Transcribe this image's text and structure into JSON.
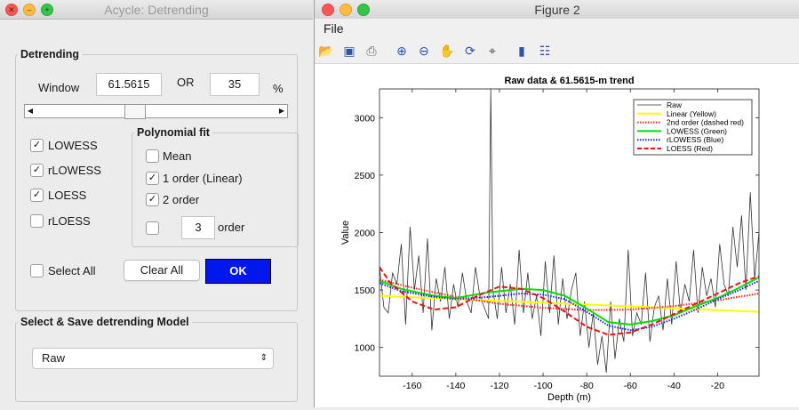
{
  "left_window": {
    "title": "Acycle: Detrending",
    "detrending": {
      "legend": "Detrending",
      "window_label": "Window",
      "window_value": "61.5615",
      "or_label": "OR",
      "percent_value": "35",
      "percent_unit": "%",
      "slider_fraction": 0.4
    },
    "methods": [
      {
        "label": "LOWESS",
        "checked": true
      },
      {
        "label": "rLOWESS",
        "checked": true
      },
      {
        "label": "LOESS",
        "checked": true
      },
      {
        "label": "rLOESS",
        "checked": false
      }
    ],
    "polyfit": {
      "legend": "Polynomial fit",
      "items": [
        {
          "label": "Mean",
          "checked": false
        },
        {
          "label": "1 order (Linear)",
          "checked": true
        },
        {
          "label": "2 order",
          "checked": true
        }
      ],
      "custom_order_value": "3",
      "custom_order_label": "order",
      "custom_checked": false
    },
    "select_all_label": "Select All",
    "clear_all_label": "Clear All",
    "ok_label": "OK",
    "model_section": {
      "legend": "Select & Save detrending Model",
      "selected": "Raw"
    }
  },
  "figure_window": {
    "title": "Figure 2",
    "menu": [
      "File"
    ],
    "toolbar_icons": [
      "open-icon",
      "save-icon",
      "print-icon",
      "zoom-in-icon",
      "zoom-out-icon",
      "pan-hand-icon",
      "rotate-3d-icon",
      "data-cursor-icon",
      "colorbar-icon",
      "legend-icon"
    ]
  },
  "chart_data": {
    "type": "line",
    "title": "Raw data & 61.5615-m trend",
    "xlabel": "Depth (m)",
    "ylabel": "Value",
    "xlim": [
      -175,
      -1
    ],
    "ylim": [
      750,
      3250
    ],
    "xticks": [
      -160,
      -140,
      -120,
      -100,
      -80,
      -60,
      -40,
      -20
    ],
    "yticks": [
      1000,
      1500,
      2000,
      2500,
      3000
    ],
    "legend_position": "top-right",
    "series": [
      {
        "name": "Raw",
        "color": "#333333",
        "style": "solid",
        "x": [
          -175,
          -173,
          -171,
          -169,
          -167,
          -165,
          -163,
          -161,
          -159,
          -157,
          -155,
          -153,
          -151,
          -149,
          -147,
          -145,
          -143,
          -141,
          -139,
          -137,
          -135,
          -133,
          -131,
          -129,
          -127,
          -125,
          -124,
          -123,
          -121,
          -119,
          -117,
          -115,
          -113,
          -111,
          -109,
          -107,
          -105,
          -103,
          -101,
          -99,
          -97,
          -95,
          -93,
          -91,
          -89,
          -87,
          -85,
          -83,
          -81,
          -79,
          -77,
          -75,
          -73,
          -71,
          -69,
          -67,
          -65,
          -63,
          -61,
          -59,
          -57,
          -55,
          -53,
          -51,
          -49,
          -47,
          -45,
          -43,
          -41,
          -39,
          -37,
          -35,
          -33,
          -31,
          -29,
          -27,
          -25,
          -23,
          -21,
          -19,
          -17,
          -15,
          -13,
          -11,
          -9,
          -7,
          -5,
          -3,
          -1
        ],
        "y": [
          1700,
          1350,
          1300,
          1650,
          1550,
          1900,
          1200,
          2050,
          1500,
          1800,
          1300,
          1950,
          1150,
          1600,
          1400,
          1700,
          1250,
          1550,
          1350,
          1650,
          1400,
          1300,
          1700,
          1450,
          1350,
          1250,
          3250,
          1500,
          1250,
          1700,
          1300,
          1550,
          1200,
          1850,
          1300,
          1650,
          1250,
          1450,
          1100,
          1750,
          1300,
          1800,
          1200,
          1600,
          1250,
          1500,
          1650,
          1100,
          1400,
          1000,
          1300,
          850,
          1100,
          780,
          1400,
          900,
          1250,
          1050,
          1850,
          1100,
          1300,
          1200,
          1650,
          1050,
          1350,
          1450,
          1150,
          1600,
          1200,
          1750,
          1300,
          1550,
          1400,
          1850,
          1300,
          1700,
          1450,
          1600,
          1350,
          1900,
          1550,
          1450,
          2050,
          1700,
          2150,
          1500,
          2350,
          1600,
          2000
        ]
      },
      {
        "name": "Linear (Yellow)",
        "color": "#ffff00",
        "style": "solid",
        "x": [
          -175,
          -1
        ],
        "y": [
          1450,
          1310
        ]
      },
      {
        "name": "2nd order (dashed red)",
        "color": "#ff2020",
        "style": "dotted",
        "x": [
          -175,
          -160,
          -140,
          -120,
          -100,
          -80,
          -60,
          -40,
          -20,
          -1
        ],
        "y": [
          1590,
          1520,
          1440,
          1380,
          1345,
          1325,
          1330,
          1360,
          1410,
          1470
        ]
      },
      {
        "name": "LOWESS  (Green)",
        "color": "#00dd00",
        "style": "solid",
        "x": [
          -175,
          -165,
          -150,
          -140,
          -125,
          -110,
          -100,
          -90,
          -80,
          -70,
          -60,
          -50,
          -40,
          -30,
          -20,
          -10,
          -1
        ],
        "y": [
          1580,
          1510,
          1450,
          1430,
          1480,
          1510,
          1500,
          1450,
          1340,
          1220,
          1200,
          1230,
          1280,
          1360,
          1430,
          1520,
          1610
        ]
      },
      {
        "name": "rLOWESS (Blue)",
        "color": "#2222ee",
        "style": "dotted",
        "x": [
          -175,
          -165,
          -150,
          -140,
          -125,
          -110,
          -100,
          -90,
          -80,
          -70,
          -60,
          -50,
          -40,
          -30,
          -20,
          -10,
          -1
        ],
        "y": [
          1560,
          1490,
          1440,
          1420,
          1440,
          1470,
          1460,
          1420,
          1310,
          1190,
          1150,
          1180,
          1250,
          1330,
          1420,
          1500,
          1580
        ]
      },
      {
        "name": "LOESS     (Red)",
        "color": "#ee1111",
        "style": "dashed",
        "x": [
          -175,
          -170,
          -160,
          -150,
          -140,
          -130,
          -120,
          -110,
          -100,
          -90,
          -80,
          -70,
          -60,
          -50,
          -40,
          -30,
          -20,
          -10,
          -1
        ],
        "y": [
          1700,
          1560,
          1400,
          1330,
          1350,
          1450,
          1530,
          1510,
          1430,
          1310,
          1180,
          1110,
          1130,
          1200,
          1290,
          1380,
          1470,
          1560,
          1620
        ]
      }
    ]
  }
}
